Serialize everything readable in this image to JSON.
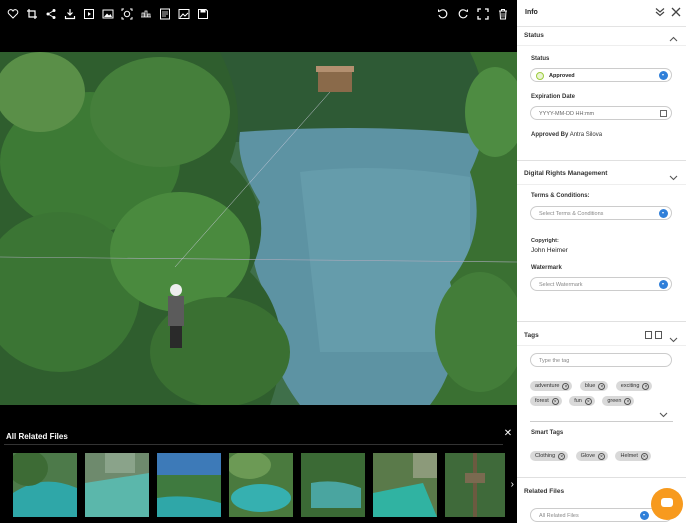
{
  "toolbar": {
    "left_icons": [
      "heart-plus-icon",
      "crop-icon",
      "share-icon",
      "download-icon",
      "slideshow-icon",
      "gallery-icon",
      "face-detect-icon",
      "compare-icon",
      "comments-icon",
      "image-edit-icon",
      "save-icon"
    ],
    "right_icons": [
      "rotate-left-icon",
      "rotate-right-icon",
      "fullscreen-icon",
      "delete-icon"
    ]
  },
  "related": {
    "title": "All Related Files",
    "thumbnail_count": 7
  },
  "panel": {
    "title": "Info",
    "status_section": {
      "heading": "Status",
      "status_label": "Status",
      "status_value": "Approved",
      "expiration_label": "Expiration Date",
      "expiration_placeholder": "YYYY-MM-DD HH:mm",
      "approved_by_label": "Approved By",
      "approved_by_value": "Antra Silova"
    },
    "drm_section": {
      "heading": "Digital Rights Management",
      "terms_label": "Terms & Conditions:",
      "terms_placeholder": "Select Terms & Conditions",
      "copyright_label": "Copyright:",
      "copyright_value": "John Heimer",
      "watermark_label": "Watermark",
      "watermark_placeholder": "Select Watermark"
    },
    "tags_section": {
      "heading": "Tags",
      "input_placeholder": "Type the tag",
      "tags": [
        "adventure",
        "blue",
        "exciting",
        "forest",
        "fun",
        "green"
      ],
      "smart_tags_label": "Smart Tags",
      "smart_tags": [
        "Clothing",
        "Glove",
        "Helmet"
      ]
    },
    "related_section": {
      "heading": "Related Files",
      "select_placeholder": "All Related Files"
    }
  },
  "colors": {
    "accent": "#2f7fd9",
    "approved": "#9ccc3c",
    "chat": "#f79a1e"
  }
}
